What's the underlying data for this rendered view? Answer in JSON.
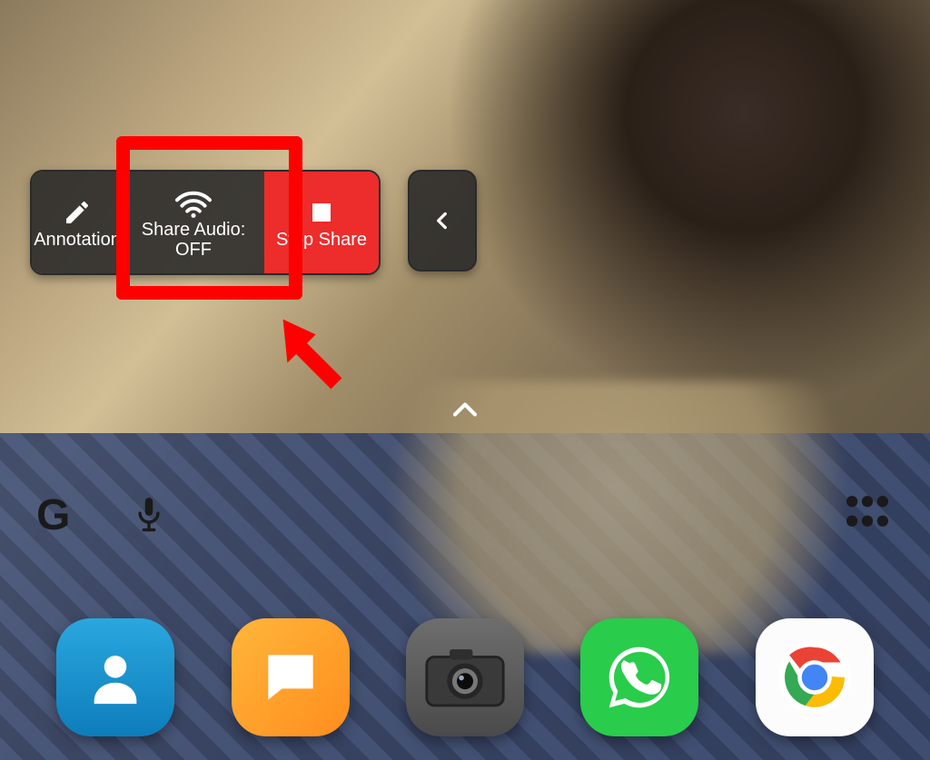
{
  "toolbar": {
    "annotation_label": "Annotation",
    "share_audio_label": "Share Audio:",
    "share_audio_state": "OFF",
    "stop_share_label": "Stop Share"
  },
  "icons": {
    "google": "G",
    "mic": "mic",
    "apps_grid": "apps"
  },
  "dock": {
    "contacts": "Contacts",
    "messages": "Messages",
    "camera": "Camera",
    "whatsapp": "WhatsApp",
    "chrome": "Chrome"
  },
  "colors": {
    "highlight": "#ff0000",
    "stop_btn": "#ed2c2c"
  }
}
